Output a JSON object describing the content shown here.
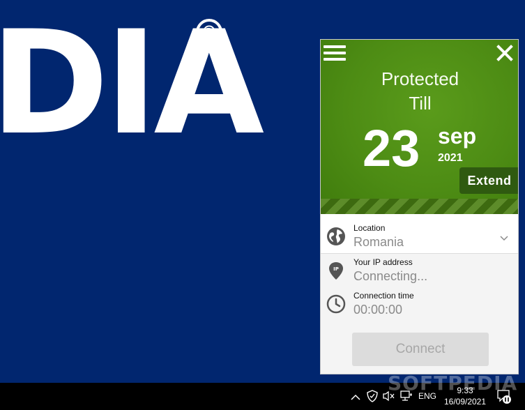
{
  "wallpaper": {
    "logo_text": "DIA",
    "reg_mark": "®"
  },
  "vpn": {
    "header": {
      "protected": "Protected",
      "till": "Till",
      "day": "23",
      "month": "sep",
      "year": "2021",
      "extend_label": "Extend"
    },
    "location": {
      "label": "Location",
      "value": "Romania"
    },
    "ip": {
      "label": "Your IP address",
      "value": "Connecting..."
    },
    "time": {
      "label": "Connection time",
      "value": "00:00:00"
    },
    "connect_label": "Connect",
    "colors": {
      "header_green": "#4d8c14",
      "extend_bg": "#2f5a10",
      "connect_disabled": "#dcdcdc"
    }
  },
  "taskbar": {
    "language": "ENG",
    "time": "9:33",
    "date": "16/09/2021",
    "watermark": "SOFTPEDIA"
  }
}
